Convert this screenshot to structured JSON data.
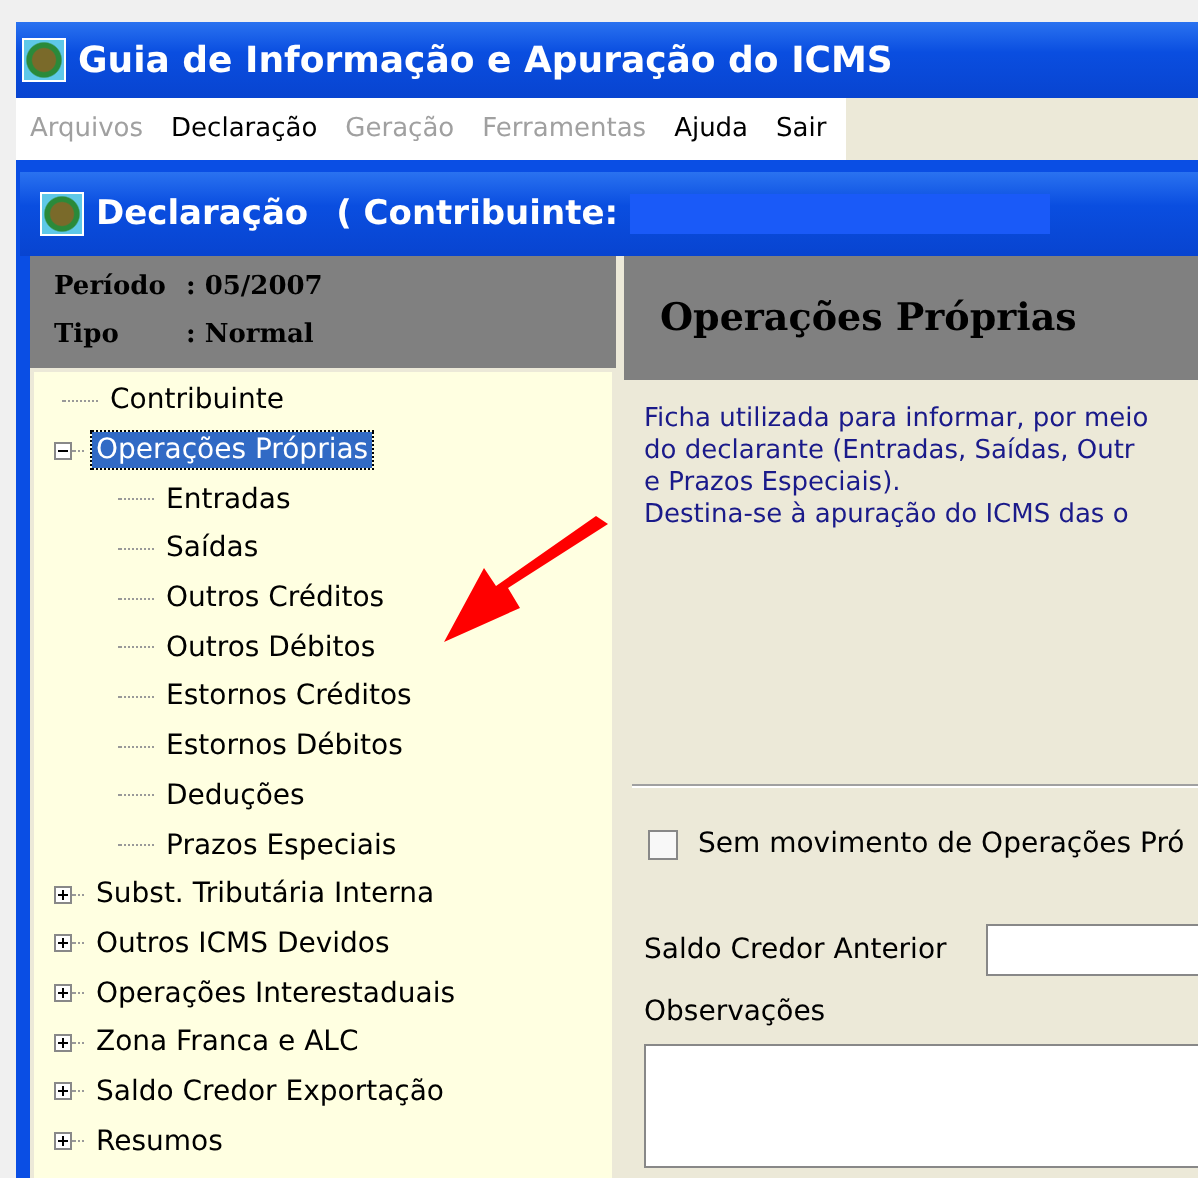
{
  "window": {
    "title": "Guia de Informação e Apuração do ICMS"
  },
  "menu": [
    {
      "label": "Arquivos",
      "disabled": true
    },
    {
      "label": "Declaração",
      "disabled": false
    },
    {
      "label": "Geração",
      "disabled": true
    },
    {
      "label": "Ferramentas",
      "disabled": true
    },
    {
      "label": "Ajuda",
      "disabled": false
    },
    {
      "label": "Sair",
      "disabled": false
    }
  ],
  "child_window": {
    "title": "Declaração",
    "contribuinte_label": "(  Contribuinte:"
  },
  "info": [
    {
      "label": "Período",
      "value": ": 05/2007"
    },
    {
      "label": "Tipo",
      "value": ": Normal"
    }
  ],
  "tree": [
    {
      "label": "Contribuinte",
      "selected": false
    },
    {
      "label": "Operações Próprias",
      "selected": true,
      "expanded": true,
      "children": [
        {
          "label": "Entradas",
          "selected": false
        },
        {
          "label": "Saídas",
          "selected": false
        },
        {
          "label": "Outros Créditos",
          "selected": false
        },
        {
          "label": "Outros Débitos",
          "selected": false
        },
        {
          "label": "Estornos Créditos",
          "selected": false
        },
        {
          "label": "Estornos Débitos",
          "selected": false
        },
        {
          "label": "Deduções",
          "selected": false
        },
        {
          "label": "Prazos Especiais",
          "selected": false
        }
      ]
    },
    {
      "label": "Subst. Tributária Interna",
      "selected": false,
      "expanded": false
    },
    {
      "label": "Outros ICMS Devidos",
      "selected": false,
      "expanded": false
    },
    {
      "label": "Operações Interestaduais",
      "selected": false,
      "expanded": false
    },
    {
      "label": "Zona Franca e ALC",
      "selected": false,
      "expanded": false
    },
    {
      "label": "Saldo Credor Exportação",
      "selected": false,
      "expanded": false
    },
    {
      "label": "Resumos",
      "selected": false,
      "expanded": false
    }
  ],
  "panel": {
    "heading": "Operações Próprias",
    "description": [
      "Ficha utilizada para informar, por meio",
      "do declarante (Entradas, Saídas, Outr",
      "e Prazos Especiais).",
      "Destina-se à apuração do ICMS das o"
    ],
    "no_movement": {
      "label": "Sem movimento de Operações Pró",
      "checked": false
    },
    "saldo_label": "Saldo Credor Anterior",
    "observacoes_label": "Observações"
  }
}
